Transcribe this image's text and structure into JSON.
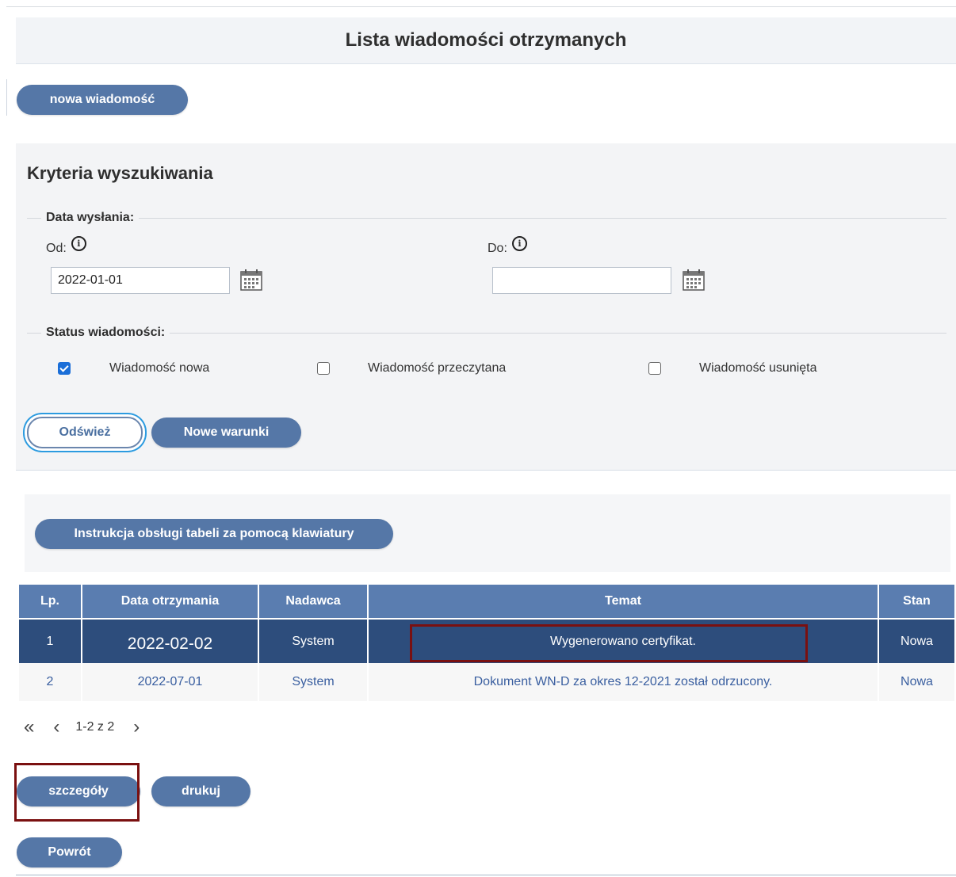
{
  "header": {
    "title": "Lista wiadomości otrzymanych"
  },
  "actions": {
    "new_message": "nowa wiadomość"
  },
  "search": {
    "title": "Kryteria wyszukiwania",
    "date_legend": "Data wysłania:",
    "from_label": "Od:",
    "from_value": "2022-01-01",
    "to_label": "Do:",
    "to_value": "",
    "status_legend": "Status wiadomości:",
    "statuses": [
      {
        "label": "Wiadomość nowa",
        "checked": true
      },
      {
        "label": "Wiadomość przeczytana",
        "checked": false
      },
      {
        "label": "Wiadomość usunięta",
        "checked": false
      }
    ],
    "refresh_label": "Odśwież",
    "new_conditions_label": "Nowe warunki"
  },
  "table": {
    "keyboard_help_label": "Instrukcja obsługi tabeli za pomocą klawiatury",
    "columns": [
      "Lp.",
      "Data otrzymania",
      "Nadawca",
      "Temat",
      "Stan"
    ],
    "rows": [
      [
        "1",
        "2022-02-02",
        "System",
        "Wygenerowano certyfikat.",
        "Nowa"
      ],
      [
        "2",
        "2022-07-01",
        "System",
        "Dokument WN-D za okres 12-2021 został odrzucony.",
        "Nowa"
      ]
    ]
  },
  "pager": {
    "info": "1-2 z 2"
  },
  "footer": {
    "details_label": "szczegóły",
    "print_label": "drukuj",
    "back_label": "Powrót"
  },
  "colors": {
    "accent": "#5577a7",
    "selected_row": "#2d4d7c",
    "highlight": "#7a1010"
  }
}
